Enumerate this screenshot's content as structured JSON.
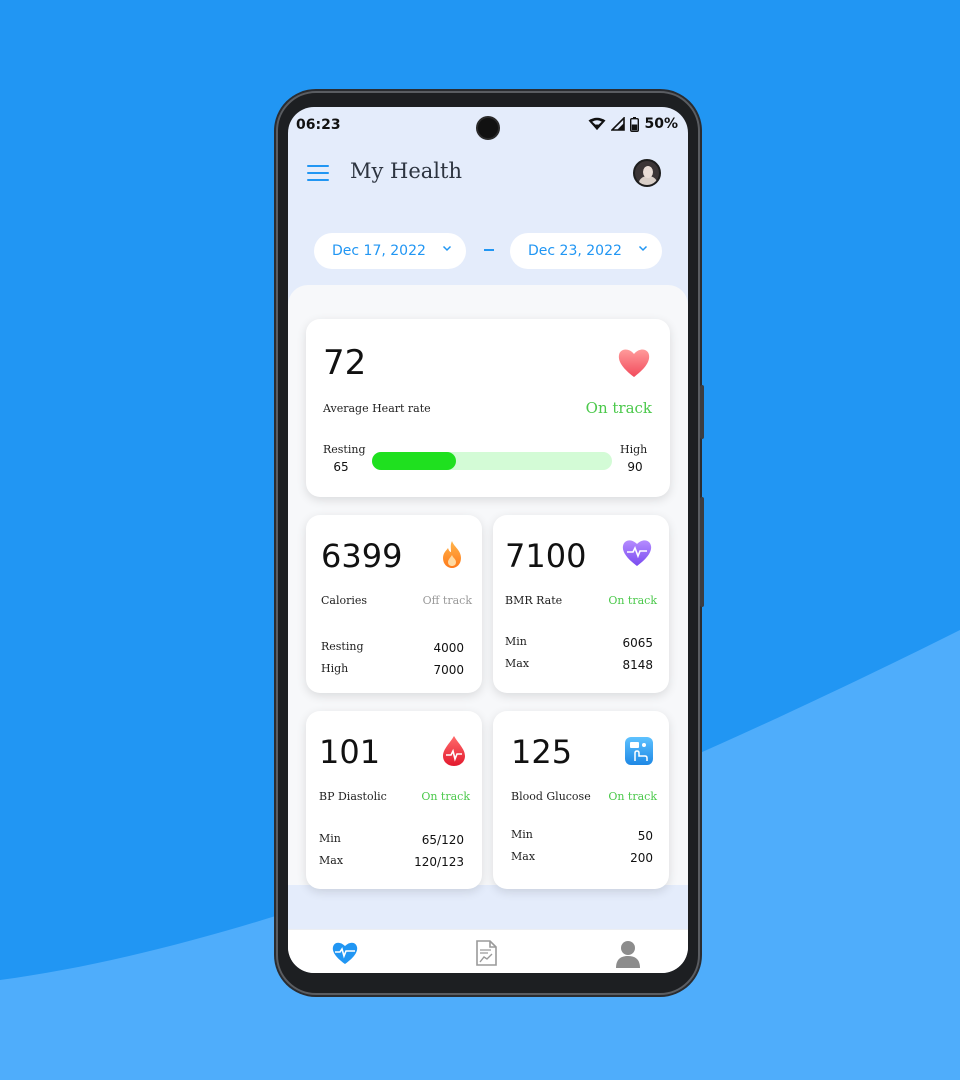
{
  "status_bar": {
    "time": "06:23",
    "battery": "50%"
  },
  "app": {
    "title": "My Health"
  },
  "date_range": {
    "start": "Dec 17, 2022",
    "end": "Dec 23, 2022"
  },
  "heart_rate": {
    "value": "72",
    "label": "Average Heart rate",
    "status": "On track",
    "resting_label": "Resting",
    "resting_value": "65",
    "high_label": "High",
    "high_value": "90",
    "progress_fraction": 0.35,
    "icon": "heart-icon"
  },
  "calories": {
    "value": "6399",
    "label": "Calories",
    "status": "Off track",
    "row1_label": "Resting",
    "row1_value": "4000",
    "row2_label": "High",
    "row2_value": "7000",
    "icon": "flame-icon"
  },
  "bmr": {
    "value": "7100",
    "label": "BMR Rate",
    "status": "On track",
    "row1_label": "Min",
    "row1_value": "6065",
    "row2_label": "Max",
    "row2_value": "8148",
    "icon": "pulse-heart-icon"
  },
  "bp": {
    "value": "101",
    "label": "BP Diastolic",
    "status": "On track",
    "row1_label": "Min",
    "row1_value": "65/120",
    "row2_label": "Max",
    "row2_value": "120/123",
    "icon": "blood-drop-icon"
  },
  "glucose": {
    "value": "125",
    "label": "Blood Glucose",
    "status": "On track",
    "row1_label": "Min",
    "row1_value": "50",
    "row2_label": "Max",
    "row2_value": "200",
    "icon": "glucose-meter-icon"
  },
  "colors": {
    "accent": "#2196f3",
    "on_track": "#4cc94c",
    "off_track": "#9a9a9a",
    "progress_fill": "#1fe01f",
    "progress_track": "#d3fbd6"
  },
  "bottom_nav": [
    "heart-pulse-icon",
    "report-icon",
    "profile-icon"
  ]
}
